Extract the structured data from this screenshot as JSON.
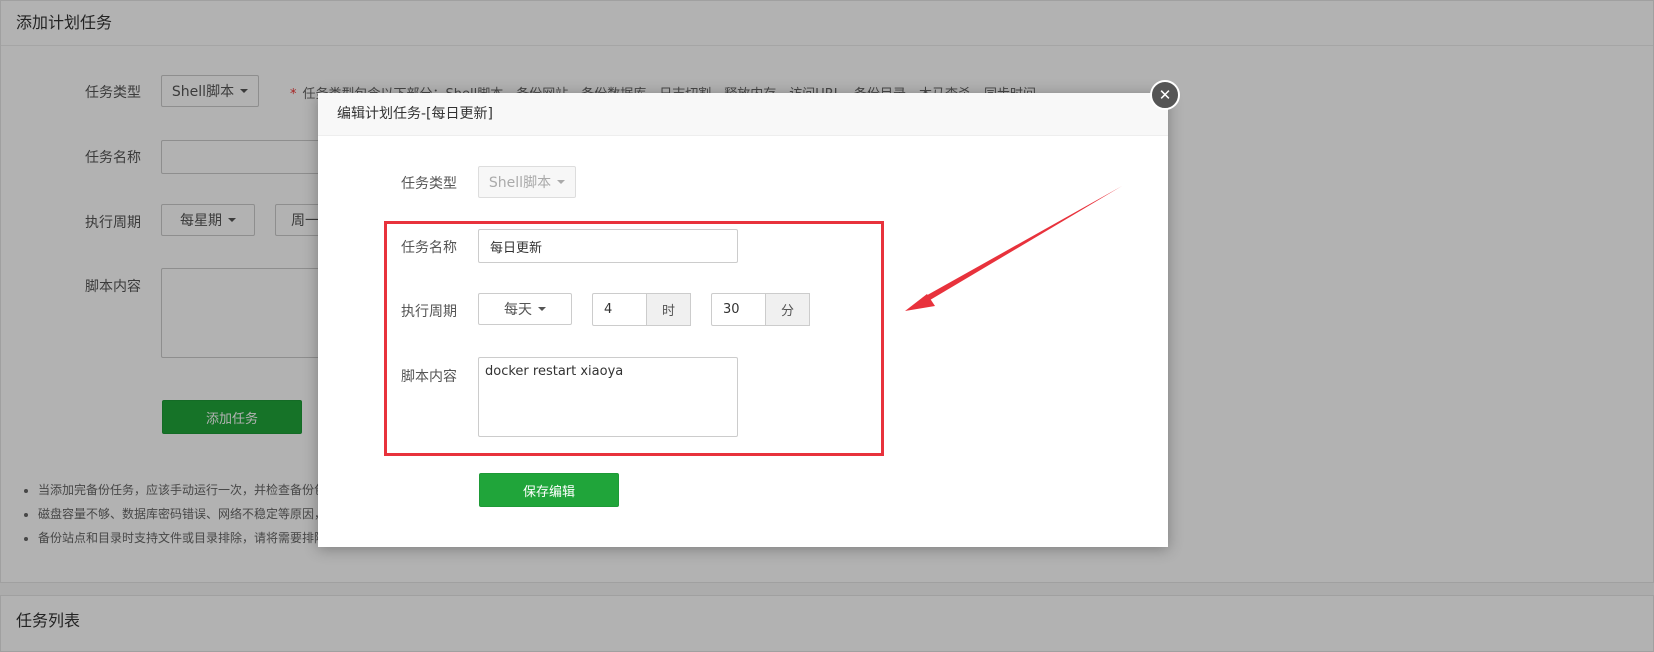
{
  "background": {
    "panel_title": "添加计划任务",
    "type_label": "任务类型",
    "type_value": "Shell脚本",
    "type_note": "任务类型包含以下部分：Shell脚本、备份网站、备份数据库、日志切割、释放内存、访问URL、备份目录、木马查杀、同步时间",
    "name_label": "任务名称",
    "cycle_label": "执行周期",
    "cycle_value": "每星期",
    "cycle_second_value": "周一",
    "script_label": "脚本内容",
    "add_button": "添加任务",
    "tips": [
      "当添加完备份任务，应该手动运行一次，并检查备份包是否完整",
      "磁盘容量不够、数据库密码错误、网络不稳定等原因，可能导致数据备份不完整",
      "备份站点和目录时支持文件或目录排除，请将需要排除的文件或目录填写在排除列表中"
    ],
    "list_title": "任务列表"
  },
  "modal": {
    "title": "编辑计划任务-[每日更新]",
    "close_symbol": "✕",
    "type_label": "任务类型",
    "type_value": "Shell脚本",
    "name_label": "任务名称",
    "name_value": "每日更新",
    "cycle_label": "执行周期",
    "cycle_value": "每天",
    "hour_value": "4",
    "hour_unit": "时",
    "minute_value": "30",
    "minute_unit": "分",
    "script_label": "脚本内容",
    "script_value": "docker restart xiaoya",
    "save_button": "保存编辑"
  },
  "colors": {
    "accent_green": "#20a53a",
    "highlight_red": "#e8323c"
  }
}
